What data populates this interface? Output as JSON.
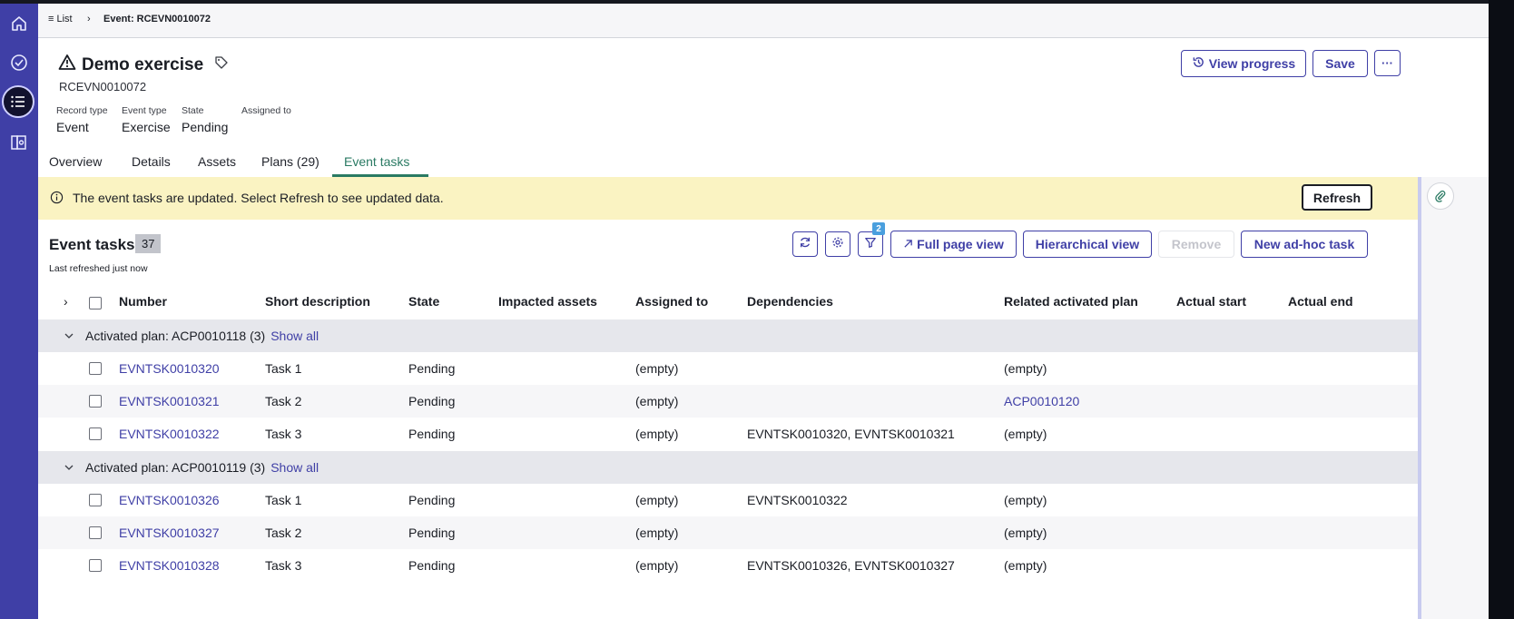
{
  "breadcrumb": {
    "list_label": "List",
    "current": "Event: RCEVN0010072"
  },
  "record": {
    "title": "Demo exercise",
    "number": "RCEVN0010072",
    "fields": [
      {
        "label": "Record type",
        "value": "Event"
      },
      {
        "label": "Event type",
        "value": "Exercise"
      },
      {
        "label": "State",
        "value": "Pending"
      },
      {
        "label": "Assigned to",
        "value": ""
      }
    ]
  },
  "header_actions": {
    "view_progress": "View progress",
    "save": "Save",
    "more": "···"
  },
  "tabs": [
    "Overview",
    "Details",
    "Assets",
    "Plans (29)",
    "Event tasks"
  ],
  "active_tab": "Event tasks",
  "banner": {
    "message": "The event tasks are updated. Select Refresh to see updated data.",
    "refresh": "Refresh"
  },
  "tasks_panel": {
    "title": "Event tasks",
    "count": "37",
    "last_refreshed": "Last refreshed just now",
    "filter_count": "2",
    "buttons": {
      "full_page": "Full page view",
      "hierarchical": "Hierarchical view",
      "remove": "Remove",
      "new_adhoc": "New ad-hoc task"
    }
  },
  "columns": [
    "Number",
    "Short description",
    "State",
    "Impacted assets",
    "Assigned to",
    "Dependencies",
    "Related activated plan",
    "Actual start",
    "Actual end"
  ],
  "groups": [
    {
      "label": "Activated plan: ACP0010118 (3)",
      "show_all": "Show all",
      "rows": [
        {
          "number": "EVNTSK0010320",
          "short_description": "Task 1",
          "state": "Pending",
          "assigned_to": "(empty)",
          "dependencies": "",
          "related_plan": "(empty)",
          "related_plan_link": false
        },
        {
          "number": "EVNTSK0010321",
          "short_description": "Task 2",
          "state": "Pending",
          "assigned_to": "(empty)",
          "dependencies": "",
          "related_plan": "ACP0010120",
          "related_plan_link": true
        },
        {
          "number": "EVNTSK0010322",
          "short_description": "Task 3",
          "state": "Pending",
          "assigned_to": "(empty)",
          "dependencies": "EVNTSK0010320, EVNTSK0010321",
          "related_plan": "(empty)",
          "related_plan_link": false
        }
      ]
    },
    {
      "label": "Activated plan: ACP0010119 (3)",
      "show_all": "Show all",
      "rows": [
        {
          "number": "EVNTSK0010326",
          "short_description": "Task 1",
          "state": "Pending",
          "assigned_to": "(empty)",
          "dependencies": "EVNTSK0010322",
          "related_plan": "(empty)",
          "related_plan_link": false
        },
        {
          "number": "EVNTSK0010327",
          "short_description": "Task 2",
          "state": "Pending",
          "assigned_to": "(empty)",
          "dependencies": "",
          "related_plan": "(empty)",
          "related_plan_link": false
        },
        {
          "number": "EVNTSK0010328",
          "short_description": "Task 3",
          "state": "Pending",
          "assigned_to": "(empty)",
          "dependencies": "EVNTSK0010326, EVNTSK0010327",
          "related_plan": "(empty)",
          "related_plan_link": false
        }
      ]
    }
  ],
  "colors": {
    "rail": "#3f3fa6",
    "accent": "#3f3fa6",
    "active_tab": "#2a7a63",
    "banner": "#faf3c2",
    "group_row": "#e6e7ec"
  },
  "icons": {
    "rail": [
      "home-icon",
      "check-circle-icon",
      "list-icon",
      "map-book-icon"
    ]
  }
}
